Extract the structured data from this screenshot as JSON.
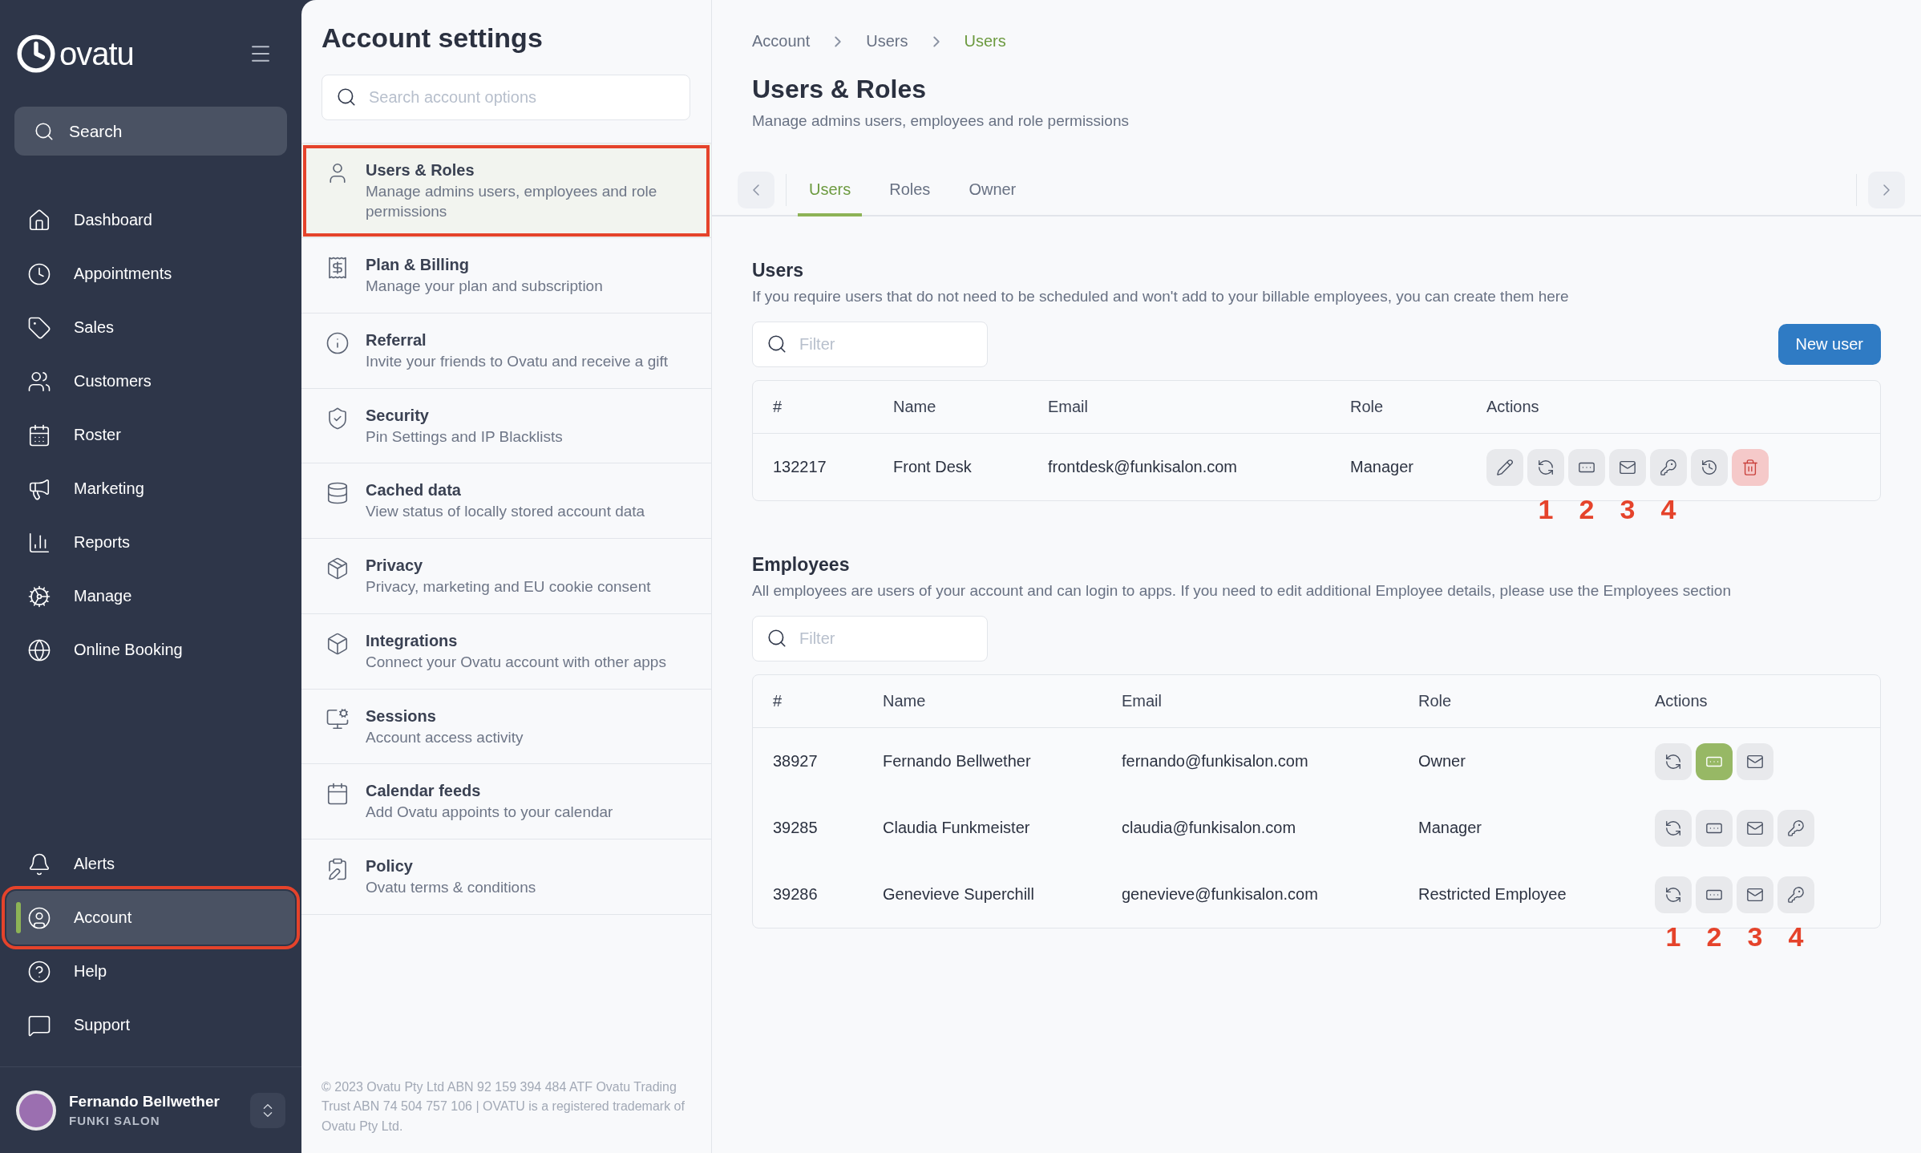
{
  "sidebar": {
    "logo": "ovatu",
    "search": {
      "placeholder": "Search"
    },
    "nav": [
      {
        "label": "Dashboard",
        "selected": false,
        "highlighted": false
      },
      {
        "label": "Appointments",
        "selected": false,
        "highlighted": false
      },
      {
        "label": "Sales",
        "selected": false,
        "highlighted": false
      },
      {
        "label": "Customers",
        "selected": false,
        "highlighted": false
      },
      {
        "label": "Roster",
        "selected": false,
        "highlighted": false
      },
      {
        "label": "Marketing",
        "selected": false,
        "highlighted": false
      },
      {
        "label": "Reports",
        "selected": false,
        "highlighted": false
      },
      {
        "label": "Manage",
        "selected": false,
        "highlighted": false
      },
      {
        "label": "Online Booking",
        "selected": false,
        "highlighted": false
      }
    ],
    "bottom_nav": [
      {
        "label": "Alerts",
        "selected": false,
        "highlighted": false
      },
      {
        "label": "Account",
        "selected": true,
        "highlighted": true
      },
      {
        "label": "Help",
        "selected": false,
        "highlighted": false
      },
      {
        "label": "Support",
        "selected": false,
        "highlighted": false
      }
    ],
    "user": {
      "name": "Fernando Bellwether",
      "business": "FUNKI SALON"
    }
  },
  "settings": {
    "title": "Account settings",
    "search": {
      "placeholder": "Search account options"
    },
    "items": [
      {
        "title": "Users & Roles",
        "description": "Manage admins users, employees and role permissions",
        "selected": true,
        "highlighted": true
      },
      {
        "title": "Plan & Billing",
        "description": "Manage your plan and subscription",
        "selected": false,
        "highlighted": false
      },
      {
        "title": "Referral",
        "description": "Invite your friends to Ovatu and receive a gift",
        "selected": false,
        "highlighted": false
      },
      {
        "title": "Security",
        "description": "Pin Settings and IP Blacklists",
        "selected": false,
        "highlighted": false
      },
      {
        "title": "Cached data",
        "description": "View status of locally stored account data",
        "selected": false,
        "highlighted": false
      },
      {
        "title": "Privacy",
        "description": "Privacy, marketing and EU cookie consent",
        "selected": false,
        "highlighted": false
      },
      {
        "title": "Integrations",
        "description": "Connect your Ovatu account with other apps",
        "selected": false,
        "highlighted": false
      },
      {
        "title": "Sessions",
        "description": "Account access activity",
        "selected": false,
        "highlighted": false
      },
      {
        "title": "Calendar feeds",
        "description": "Add Ovatu appoints to your calendar",
        "selected": false,
        "highlighted": false
      },
      {
        "title": "Policy",
        "description": "Ovatu terms & conditions",
        "selected": false,
        "highlighted": false
      }
    ],
    "footer": "© 2023 Ovatu Pty Ltd ABN 92 159 394 484 ATF Ovatu Trading Trust ABN 74 504 757 106 | OVATU is a registered trademark of Ovatu Pty Ltd."
  },
  "main": {
    "breadcrumb": [
      {
        "label": "Account",
        "selected": false
      },
      {
        "label": "Users",
        "selected": false
      },
      {
        "label": "Users",
        "selected": true
      }
    ],
    "title": "Users & Roles",
    "subtitle": "Manage admins users, employees and role permissions",
    "tabs": [
      {
        "label": "Users",
        "selected": true
      },
      {
        "label": "Roles",
        "selected": false
      },
      {
        "label": "Owner",
        "selected": false
      }
    ],
    "users": {
      "title": "Users",
      "description": "If you require users that do not need to be scheduled and won't add to your billable employees, you can create them here",
      "filter": {
        "placeholder": "Filter"
      },
      "new_button": "New user",
      "columns": [
        "#",
        "Name",
        "Email",
        "Role",
        "Actions"
      ],
      "rows": [
        {
          "cells": [
            "132217",
            "Front Desk",
            "frontdesk@funkisalon.com",
            "Manager"
          ],
          "actions": [
            {
              "kind": "edit",
              "active": false
            },
            {
              "kind": "reset",
              "active": false,
              "annotation": "1"
            },
            {
              "kind": "pin",
              "active": false,
              "annotation": "2"
            },
            {
              "kind": "email",
              "active": false,
              "annotation": "3"
            },
            {
              "kind": "keys",
              "active": false,
              "annotation": "4"
            },
            {
              "kind": "history",
              "active": false
            },
            {
              "kind": "delete",
              "active": false
            }
          ]
        }
      ]
    },
    "employees": {
      "title": "Employees",
      "description": "All employees are users of your account and can login to apps. If you need to edit additional Employee details, please use the Employees section",
      "filter": {
        "placeholder": "Filter"
      },
      "columns": [
        "#",
        "Name",
        "Email",
        "Role",
        "Actions"
      ],
      "rows": [
        {
          "cells": [
            "38927",
            "Fernando Bellwether",
            "fernando@funkisalon.com",
            "Owner"
          ],
          "actions": [
            {
              "kind": "reset",
              "active": false
            },
            {
              "kind": "pin",
              "active": true
            },
            {
              "kind": "email",
              "active": false
            }
          ]
        },
        {
          "cells": [
            "39285",
            "Claudia Funkmeister",
            "claudia@funkisalon.com",
            "Manager"
          ],
          "actions": [
            {
              "kind": "reset",
              "active": false
            },
            {
              "kind": "pin",
              "active": false
            },
            {
              "kind": "email",
              "active": false
            },
            {
              "kind": "keys",
              "active": false
            }
          ]
        },
        {
          "cells": [
            "39286",
            "Genevieve Superchill",
            "genevieve@funkisalon.com",
            "Restricted Employee"
          ],
          "actions": [
            {
              "kind": "reset",
              "active": false,
              "annotation": "1"
            },
            {
              "kind": "pin",
              "active": false,
              "annotation": "2"
            },
            {
              "kind": "email",
              "active": false,
              "annotation": "3"
            },
            {
              "kind": "keys",
              "active": false,
              "annotation": "4"
            }
          ]
        }
      ]
    }
  }
}
